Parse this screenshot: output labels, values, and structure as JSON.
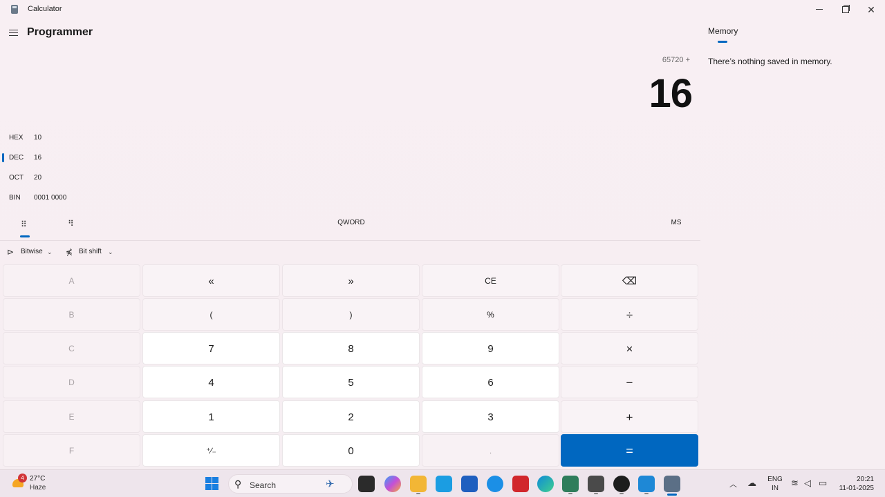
{
  "window": {
    "title": "Calculator",
    "controls": {
      "minimize": "minimize",
      "maximize": "restore",
      "close": "✕"
    }
  },
  "header": {
    "mode": "Programmer",
    "menu_icon": "hamburger-icon"
  },
  "display": {
    "expression": "65720 +",
    "value": "16"
  },
  "radix": [
    {
      "label": "HEX",
      "value": "10",
      "selected": false
    },
    {
      "label": "DEC",
      "value": "16",
      "selected": true
    },
    {
      "label": "OCT",
      "value": "20",
      "selected": false
    },
    {
      "label": "BIN",
      "value": "0001 0000",
      "selected": false
    }
  ],
  "toolbar": {
    "keypad_icon": "keypad-icon",
    "bit_toggle_icon": "bit-toggle-icon",
    "word_size": "QWORD",
    "memory_store": "MS"
  },
  "dropdowns": {
    "bitwise": "Bitwise",
    "bitshift": "Bit shift"
  },
  "keys": [
    [
      "A",
      "«",
      "»",
      "CE",
      "⌫"
    ],
    [
      "B",
      "(",
      ")",
      "%",
      "÷"
    ],
    [
      "C",
      "7",
      "8",
      "9",
      "×"
    ],
    [
      "D",
      "4",
      "5",
      "6",
      "−"
    ],
    [
      "E",
      "1",
      "2",
      "3",
      "+"
    ],
    [
      "F",
      "⁺∕₋",
      "0",
      ".",
      "="
    ]
  ],
  "memory": {
    "tab": "Memory",
    "empty_message": "There’s nothing saved in memory."
  },
  "taskbar": {
    "weather": {
      "badge": "4",
      "temp": "27°C",
      "condition": "Haze"
    },
    "search_label": "Search",
    "language": [
      "ENG",
      "IN"
    ],
    "time": "20:21",
    "date": "11-01-2025"
  },
  "colors": {
    "accent": "#0067c0",
    "background": "#f7eff3"
  }
}
